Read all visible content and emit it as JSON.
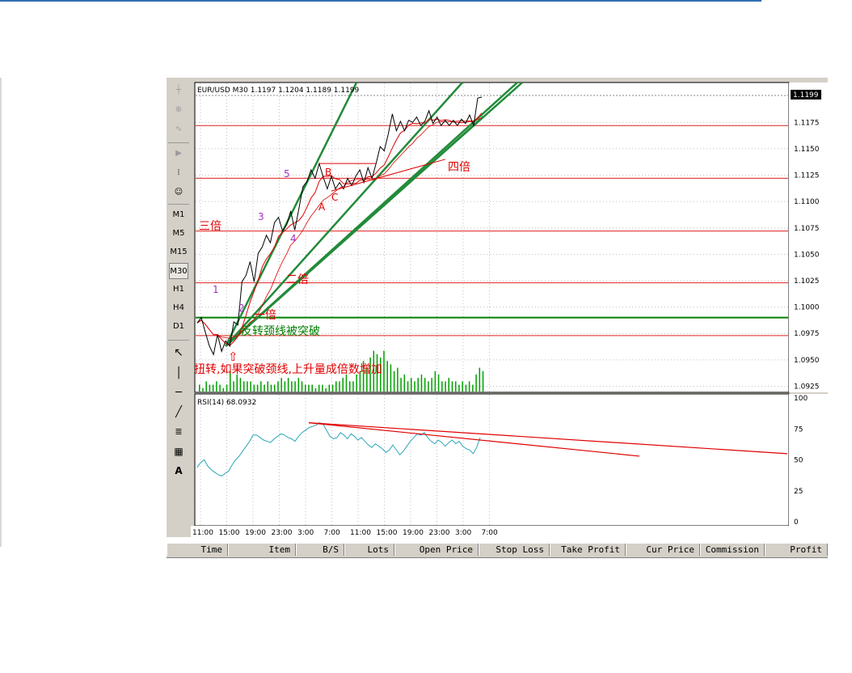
{
  "chart_title": "EUR/USD M30   1.1197   1.1204   1.1189   1.1199",
  "rsi_title": "RSI(14)  68.0932",
  "current_price_label": "1.1199",
  "timeframes": [
    "M1",
    "M5",
    "M15",
    "M30",
    "H1",
    "H4",
    "D1"
  ],
  "columns": [
    "Time",
    "Item",
    "B/S",
    "Lots",
    "Open Price",
    "Stop Loss",
    "Take Profit",
    "Cur Price",
    "Commission",
    "Profit"
  ],
  "annotations": {
    "fold3": "三倍",
    "fold2": "二倍",
    "fold1": "一倍",
    "fold4": "四倍",
    "neck": "反转颈线被突破",
    "note": "扭转,如果突破颈线,上升量成倍数增加",
    "arrow": "⇧",
    "w1": "1",
    "w2": "2",
    "w3": "3",
    "w4": "4",
    "w5": "5",
    "wa": "A",
    "wb": "B",
    "wc": "C"
  },
  "colors": {
    "price_line": "#000000",
    "ma_red": "#e00000",
    "level_line": "#e02020",
    "fan_line": "#228b3a",
    "neckline": "#008000",
    "volume": "#00a000",
    "rsi": "#2aa6b8",
    "note_text": "#e00000"
  },
  "chart_data": {
    "type": "line",
    "symbol": "EUR/USD",
    "timeframe": "M30",
    "ohlc_last": {
      "open": 1.1197,
      "high": 1.1204,
      "low": 1.1189,
      "close": 1.1199
    },
    "x_tick_labels": [
      "11:00",
      "15:00",
      "19:00",
      "23:00",
      "3:00",
      "7:00",
      "11:00",
      "15:00",
      "19:00",
      "23:00",
      "3:00",
      "7:00"
    ],
    "price_axis_ticks": [
      1.1175,
      1.115,
      1.1125,
      1.11,
      1.1075,
      1.105,
      1.1025,
      1.1,
      1.0975,
      1.095,
      1.0925
    ],
    "ylim": [
      1.092,
      1.1212
    ],
    "horizontal_levels": [
      1.1172,
      1.1122,
      1.1072,
      1.1023,
      1.0973
    ],
    "neckline": 1.099,
    "price_series": [
      {
        "bar": 0,
        "price": 1.0985
      },
      {
        "bar": 1,
        "price": 1.099
      },
      {
        "bar": 2,
        "price": 1.0976
      },
      {
        "bar": 3,
        "price": 1.0963
      },
      {
        "bar": 4,
        "price": 1.0955
      },
      {
        "bar": 5,
        "price": 1.0974
      },
      {
        "bar": 6,
        "price": 1.0958
      },
      {
        "bar": 7,
        "price": 1.0968
      },
      {
        "bar": 8,
        "price": 1.0963
      },
      {
        "bar": 9,
        "price": 1.0986
      },
      {
        "bar": 10,
        "price": 1.0983
      },
      {
        "bar": 11,
        "price": 1.1024
      },
      {
        "bar": 12,
        "price": 1.103
      },
      {
        "bar": 13,
        "price": 1.1043
      },
      {
        "bar": 14,
        "price": 1.1024
      },
      {
        "bar": 15,
        "price": 1.1051
      },
      {
        "bar": 16,
        "price": 1.1057
      },
      {
        "bar": 17,
        "price": 1.1068
      },
      {
        "bar": 18,
        "price": 1.1061
      },
      {
        "bar": 19,
        "price": 1.108
      },
      {
        "bar": 20,
        "price": 1.1085
      },
      {
        "bar": 21,
        "price": 1.1072
      },
      {
        "bar": 22,
        "price": 1.1078
      },
      {
        "bar": 23,
        "price": 1.1091
      },
      {
        "bar": 24,
        "price": 1.1073
      },
      {
        "bar": 25,
        "price": 1.1093
      },
      {
        "bar": 26,
        "price": 1.1114
      },
      {
        "bar": 27,
        "price": 1.1119
      },
      {
        "bar": 28,
        "price": 1.113
      },
      {
        "bar": 29,
        "price": 1.1122
      },
      {
        "bar": 30,
        "price": 1.1136
      },
      {
        "bar": 31,
        "price": 1.1123
      },
      {
        "bar": 32,
        "price": 1.1112
      },
      {
        "bar": 33,
        "price": 1.1124
      },
      {
        "bar": 34,
        "price": 1.1112
      },
      {
        "bar": 35,
        "price": 1.1118
      },
      {
        "bar": 36,
        "price": 1.1112
      },
      {
        "bar": 37,
        "price": 1.1122
      },
      {
        "bar": 38,
        "price": 1.1115
      },
      {
        "bar": 39,
        "price": 1.1124
      },
      {
        "bar": 40,
        "price": 1.113
      },
      {
        "bar": 41,
        "price": 1.1118
      },
      {
        "bar": 42,
        "price": 1.1132
      },
      {
        "bar": 43,
        "price": 1.1122
      },
      {
        "bar": 44,
        "price": 1.1136
      },
      {
        "bar": 45,
        "price": 1.1152
      },
      {
        "bar": 46,
        "price": 1.1148
      },
      {
        "bar": 47,
        "price": 1.1164
      },
      {
        "bar": 48,
        "price": 1.1183
      },
      {
        "bar": 49,
        "price": 1.1167
      },
      {
        "bar": 50,
        "price": 1.1176
      },
      {
        "bar": 51,
        "price": 1.1167
      },
      {
        "bar": 52,
        "price": 1.1177
      },
      {
        "bar": 53,
        "price": 1.1175
      },
      {
        "bar": 54,
        "price": 1.118
      },
      {
        "bar": 55,
        "price": 1.1172
      },
      {
        "bar": 56,
        "price": 1.1176
      },
      {
        "bar": 57,
        "price": 1.1186
      },
      {
        "bar": 58,
        "price": 1.1174
      },
      {
        "bar": 59,
        "price": 1.118
      },
      {
        "bar": 60,
        "price": 1.1172
      },
      {
        "bar": 61,
        "price": 1.1177
      },
      {
        "bar": 62,
        "price": 1.1172
      },
      {
        "bar": 63,
        "price": 1.1177
      },
      {
        "bar": 64,
        "price": 1.1172
      },
      {
        "bar": 65,
        "price": 1.1178
      },
      {
        "bar": 66,
        "price": 1.1174
      },
      {
        "bar": 67,
        "price": 1.1182
      },
      {
        "bar": 68,
        "price": 1.1172
      },
      {
        "bar": 69,
        "price": 1.1198
      },
      {
        "bar": 70,
        "price": 1.1199
      }
    ],
    "volume": [
      2,
      1,
      3,
      2,
      2,
      3,
      2,
      1,
      2,
      6,
      3,
      5,
      4,
      3,
      3,
      3,
      2,
      2,
      3,
      2,
      3,
      2,
      2,
      3,
      4,
      3,
      4,
      3,
      3,
      4,
      3,
      2,
      2,
      2,
      1,
      2,
      2,
      1,
      2,
      2,
      3,
      3,
      4,
      5,
      3,
      3,
      5,
      6,
      9,
      7,
      10,
      12,
      11,
      10,
      12,
      9,
      8,
      6,
      7,
      4,
      5,
      3,
      4,
      3,
      4,
      5,
      4,
      3,
      4,
      6,
      5,
      3,
      3,
      4,
      3,
      3,
      2,
      3,
      2,
      3,
      2,
      5,
      7,
      6
    ],
    "rsi": {
      "period": 14,
      "ylim": [
        0,
        100
      ],
      "ticks": [
        100,
        75,
        50,
        25,
        0
      ],
      "values": [
        44,
        48,
        50,
        45,
        42,
        40,
        38,
        37,
        39,
        41,
        46,
        50,
        53,
        57,
        61,
        65,
        70,
        70,
        68,
        66,
        65,
        64,
        67,
        69,
        71,
        70,
        68,
        67,
        65,
        69,
        72,
        74,
        76,
        77,
        78,
        80,
        79,
        74,
        69,
        67,
        68,
        72,
        70,
        67,
        71,
        69,
        66,
        68,
        65,
        62,
        60,
        63,
        61,
        59,
        56,
        58,
        62,
        58,
        54,
        57,
        61,
        65,
        68,
        71,
        70,
        72,
        68,
        65,
        63,
        66,
        64,
        61,
        64,
        66,
        63,
        65,
        61,
        59,
        58,
        55,
        60,
        68
      ]
    }
  }
}
